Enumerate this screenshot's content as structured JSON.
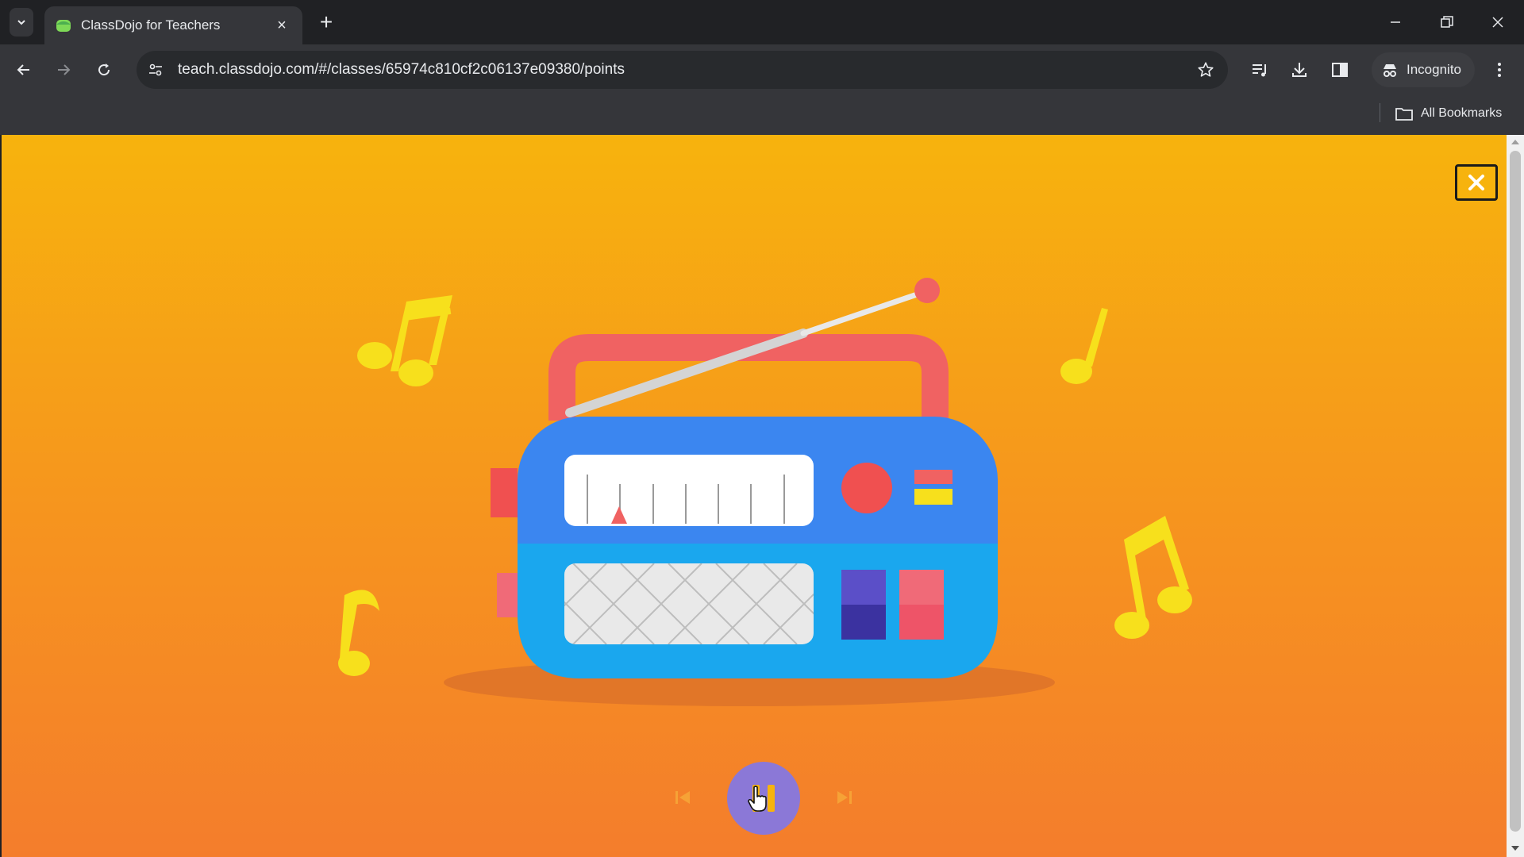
{
  "browser": {
    "tab": {
      "title": "ClassDojo for Teachers",
      "favicon": "classdojo-icon",
      "close_icon": "×"
    },
    "new_tab_icon": "+",
    "address_bar": {
      "url": "teach.classdojo.com/#/classes/65974c810cf2c06137e09380/points"
    },
    "profile": {
      "label": "Incognito"
    },
    "bookmarks": {
      "all_bookmarks_label": "All Bookmarks"
    },
    "icons": [
      "tab-search-icon",
      "back-icon",
      "forward-icon",
      "reload-icon",
      "site-info-icon",
      "star-icon",
      "media-controls-icon",
      "download-icon",
      "side-panel-icon",
      "incognito-icon",
      "kebab-menu-icon",
      "minimize-icon",
      "restore-icon",
      "close-window-icon",
      "folder-icon"
    ]
  },
  "page": {
    "close_button_glyph": "✕",
    "player": {
      "state": "playing",
      "controls": [
        "previous-track",
        "pause",
        "next-track"
      ]
    },
    "colors": {
      "background_top": "#f7b30d",
      "background_bottom": "#f47d2c",
      "radio_body": "#3b86f0",
      "radio_lower": "#1aa7ee",
      "accent_red": "#f06262",
      "note_yellow": "#f7e01c",
      "play_button": "#8b78d7"
    }
  }
}
